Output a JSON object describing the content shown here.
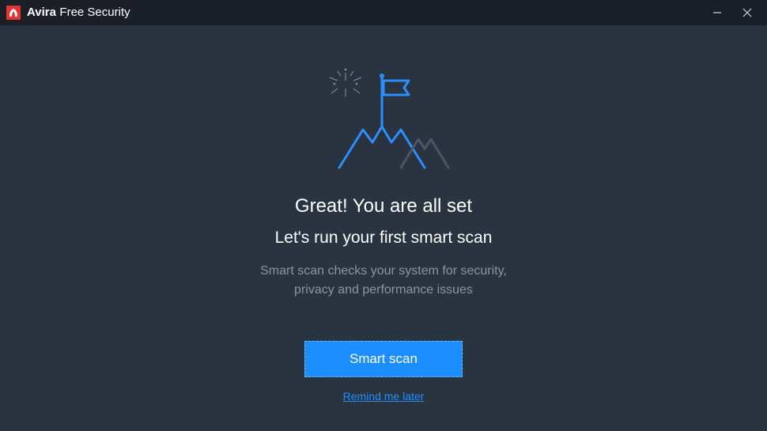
{
  "titlebar": {
    "brand": "Avira",
    "product": "Free Security"
  },
  "main": {
    "heading": "Great! You are all set",
    "subheading": "Let's run your first smart scan",
    "description_line1": "Smart scan checks your system for security,",
    "description_line2": "privacy and performance issues",
    "primary_button": "Smart scan",
    "secondary_link": "Remind me later"
  },
  "colors": {
    "accent": "#1d8eff",
    "background": "#2a3340",
    "titlebar": "#1a1f28"
  }
}
